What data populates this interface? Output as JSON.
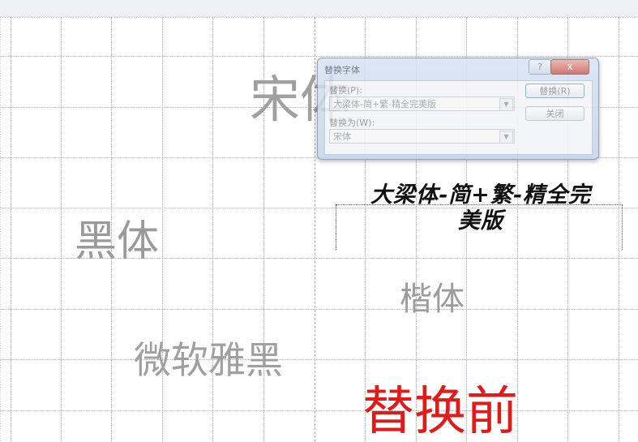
{
  "canvas": {
    "labels": {
      "songti": "宋体",
      "heiti": "黑体",
      "kaiti": "楷体",
      "yahei": "微软雅黑",
      "before": "替换前",
      "brush_font_line1": "大梁体-简+繁-精全完",
      "brush_font_line2": "美版"
    }
  },
  "dialog": {
    "title": "替换字体",
    "help_icon": "?",
    "close_icon": "x",
    "replace_label": "替换(P):",
    "replace_value": "大梁体-简+繁-精全完美版",
    "with_label": "替换为(W):",
    "with_value": "宋体",
    "replace_button": "替换(R)",
    "close_button": "关闭"
  },
  "colors": {
    "accent_red": "#e01b1b",
    "dialog_frame": "#c3d3e8"
  }
}
